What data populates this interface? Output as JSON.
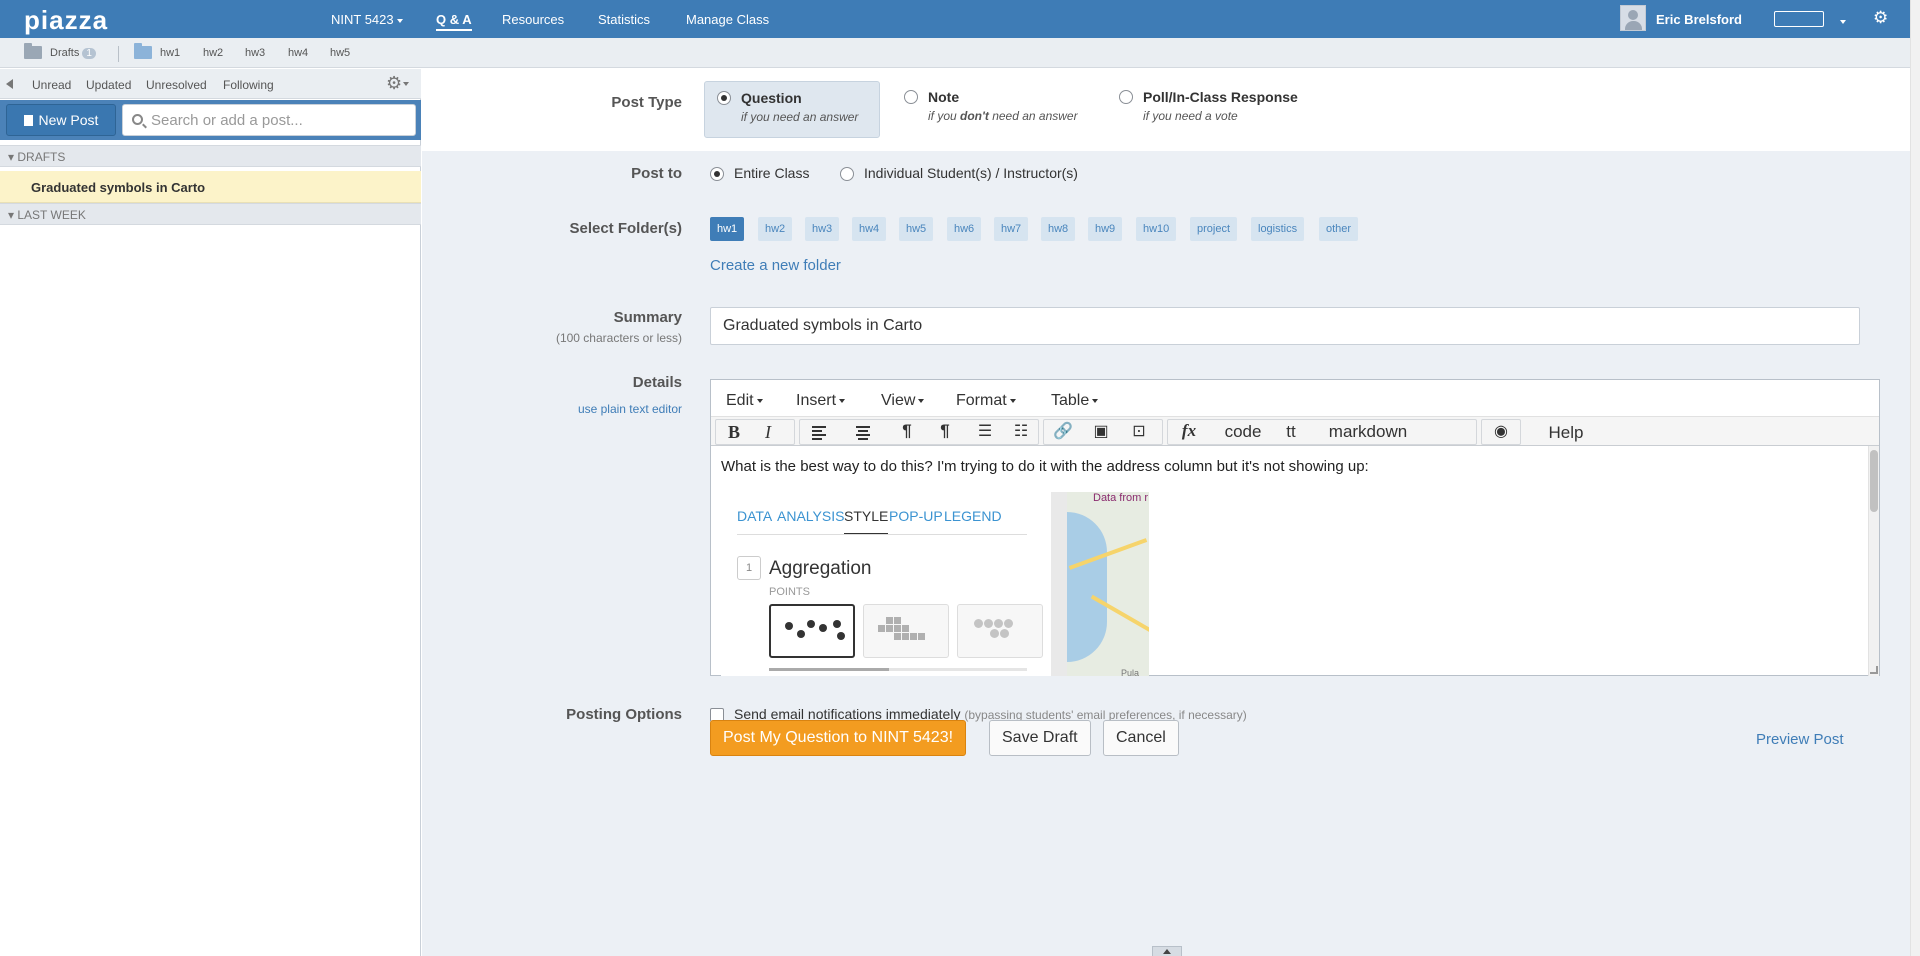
{
  "topbar": {
    "logo": "piazza",
    "class_menu": "NINT 5423",
    "nav": [
      "Q & A",
      "Resources",
      "Statistics",
      "Manage Class"
    ],
    "user_name": "Eric Brelsford"
  },
  "folderbar": {
    "drafts_label": "Drafts",
    "drafts_count": "1",
    "folders": [
      "hw1",
      "hw2",
      "hw3",
      "hw4",
      "hw5"
    ]
  },
  "sidebar": {
    "filters": [
      "Unread",
      "Updated",
      "Unresolved",
      "Following"
    ],
    "new_post_label": "New Post",
    "search_placeholder": "Search or add a post...",
    "drafts_header": "▾ DRAFTS",
    "draft_item": "Graduated symbols in Carto",
    "last_week_header": "▾ LAST WEEK"
  },
  "form": {
    "post_type_label": "Post Type",
    "post_types": [
      {
        "title": "Question",
        "sub": "if you need an answer",
        "selected": true
      },
      {
        "title": "Note",
        "sub_pre": "if you ",
        "sub_bold": "don't",
        "sub_post": " need an answer",
        "selected": false
      },
      {
        "title": "Poll/In-Class Response",
        "sub": "if you need a vote",
        "selected": false
      }
    ],
    "post_to_label": "Post to",
    "post_to_options": [
      "Entire Class",
      "Individual Student(s) / Instructor(s)"
    ],
    "select_folders_label": "Select Folder(s)",
    "folder_tags": [
      "hw1",
      "hw2",
      "hw3",
      "hw4",
      "hw5",
      "hw6",
      "hw7",
      "hw8",
      "hw9",
      "hw10",
      "project",
      "logistics",
      "other"
    ],
    "create_folder_link": "Create a new folder",
    "summary_label": "Summary",
    "summary_sublabel": "(100 characters or less)",
    "summary_value": "Graduated symbols in Carto",
    "details_label": "Details",
    "plain_text_link": "use plain text editor",
    "posting_options_label": "Posting Options",
    "email_option": "Send email notifications immediately",
    "email_option_note": "(bypassing students' email preferences, if necessary)"
  },
  "editor": {
    "menus": [
      "Edit",
      "Insert",
      "View",
      "Format",
      "Table"
    ],
    "toolbar_text": {
      "bold": "B",
      "italic": "I",
      "code": "code",
      "tt": "tt",
      "markdown": "markdown",
      "help": "Help",
      "formula": "fx"
    },
    "body_text": "What is the best way to do this? I'm trying to do it with the address column but it's not showing up:",
    "embedded": {
      "tabs": [
        "DATA",
        "ANALYSIS",
        "STYLE",
        "POP-UP",
        "LEGEND"
      ],
      "step_number": "1",
      "heading": "Aggregation",
      "subheading": "POINTS",
      "map_label": "Data from r",
      "map_label_bottom": "Pula"
    }
  },
  "actions": {
    "submit_label": "Post My Question to NINT 5423!",
    "save_draft_label": "Save Draft",
    "cancel_label": "Cancel",
    "preview_label": "Preview Post"
  }
}
